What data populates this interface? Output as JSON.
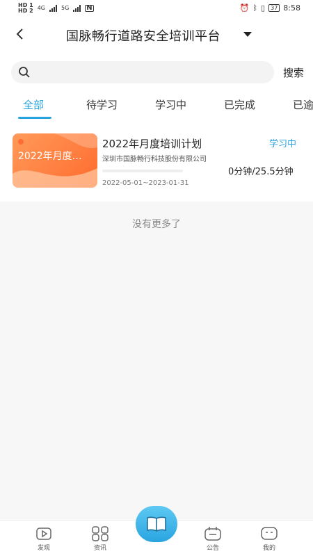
{
  "status_bar": {
    "hd1": "HD 1",
    "hd2": "HD 2",
    "net1": "4G",
    "net2": "5G",
    "battery": "37",
    "time": "8:58"
  },
  "header": {
    "title": "国脉畅行道路安全培训平台"
  },
  "search": {
    "placeholder": "",
    "value": "",
    "button_label": "搜索"
  },
  "tabs": [
    {
      "label": "全部",
      "active": true
    },
    {
      "label": "待学习",
      "active": false
    },
    {
      "label": "学习中",
      "active": false
    },
    {
      "label": "已完成",
      "active": false
    },
    {
      "label": "已逾",
      "active": false
    }
  ],
  "courses": [
    {
      "thumbnail_text": "2022年月度…",
      "title": "2022年月度培训计划",
      "status": "学习中",
      "organization": "深圳市国脉畅行科技股份有限公司",
      "progress": 0,
      "time": "0分钟/25.5分钟",
      "dates": "2022-05-01~2023-01-31"
    }
  ],
  "list_footer": "没有更多了",
  "bottom_nav": {
    "items": [
      {
        "label": "发现",
        "icon": "play-icon"
      },
      {
        "label": "资讯",
        "icon": "grid-icon"
      },
      {
        "label": "",
        "icon": "book-icon"
      },
      {
        "label": "公告",
        "icon": "notice-icon"
      },
      {
        "label": "我的",
        "icon": "profile-icon"
      }
    ]
  },
  "colors": {
    "accent": "#2aa4e0",
    "thumbnail": "#ff7e3f"
  }
}
